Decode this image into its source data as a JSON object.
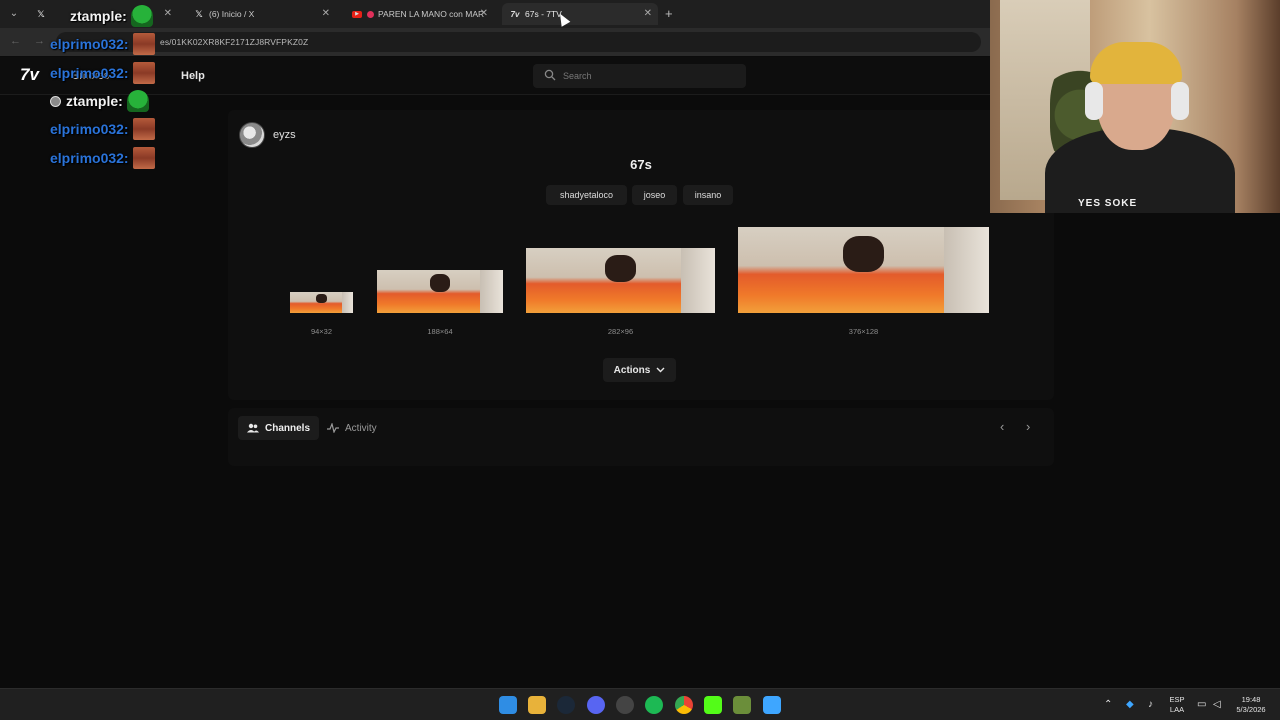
{
  "browser": {
    "tabs": [
      {
        "title": "",
        "icon": "x-icon",
        "active": false
      },
      {
        "title": "(6) Inicio / X",
        "icon": "x-icon",
        "active": false
      },
      {
        "title": "PAREN LA MANO con MAR",
        "icon": "youtube-icon",
        "active": false
      },
      {
        "title": "67s - 7TV",
        "icon": "7tv-icon",
        "active": true
      }
    ],
    "new_tab": "+",
    "url": "es/01KK02XR8KF2171ZJ8RVFPKZ0Z"
  },
  "site": {
    "logo": "7v",
    "nav": {
      "emotes": "Emotes",
      "help": "Help"
    },
    "search": {
      "placeholder": "Search"
    }
  },
  "emote": {
    "owner": "eyzs",
    "name": "67s",
    "tags": [
      "shadyetaloco",
      "joseo",
      "insano"
    ],
    "sizes": [
      "94×32",
      "188×64",
      "282×96",
      "376×128"
    ],
    "actions_label": "Actions"
  },
  "panel": {
    "tabs": [
      {
        "label": "Channels",
        "active": true
      },
      {
        "label": "Activity",
        "active": false
      }
    ]
  },
  "chat": [
    {
      "user": "ztample:",
      "emote": "green"
    },
    {
      "user": "elprimo032:",
      "emote": "face"
    },
    {
      "user": "elprimo032:",
      "emote": "face"
    },
    {
      "user": "ztample:",
      "emote": "green"
    },
    {
      "user": "elprimo032:",
      "emote": "face"
    },
    {
      "user": "elprimo032:",
      "emote": "face"
    }
  ],
  "webcam": {
    "shirt_text": "YES SOKE"
  },
  "taskbar": {
    "lang_top": "ESP",
    "lang_bottom": "LAA",
    "time": "19:48",
    "date": "5/3/2026"
  },
  "colors": {
    "chat_user_blue": "#2a73d9",
    "accent_bg": "#0b0b0b"
  }
}
